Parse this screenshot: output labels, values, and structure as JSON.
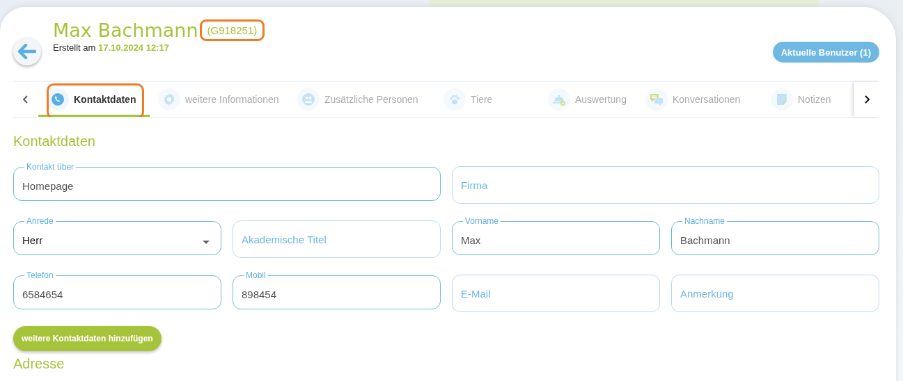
{
  "header": {
    "name": "Max Bachmann",
    "customer_id": "(G918251)",
    "customer_id_highlighted": true,
    "created_label": "Erstellt am",
    "created_at": "17.10.2024 12:17",
    "users_button": "Aktuelle Benutzer (1)"
  },
  "tabs": [
    {
      "label": "Kontaktdaten",
      "selected": true,
      "highlighted": true
    },
    {
      "label": "weitere Informationen",
      "selected": false,
      "highlighted": false
    },
    {
      "label": "Zusätzliche Personen",
      "selected": false,
      "highlighted": false
    },
    {
      "label": "Tiere",
      "selected": false,
      "highlighted": false
    },
    {
      "label": "Auswertung",
      "selected": false,
      "highlighted": false
    },
    {
      "label": "Konversationen",
      "selected": false,
      "highlighted": false
    },
    {
      "label": "Notizen",
      "selected": false,
      "highlighted": false
    }
  ],
  "section_title": "Kontaktdaten",
  "form_rows": [
    [
      {
        "kind": "text",
        "label": "Kontakt über",
        "value": "Homepage"
      },
      {
        "kind": "text",
        "placeholder": "Firma"
      }
    ],
    [
      {
        "kind": "select",
        "label": "Anrede",
        "value": "Herr"
      },
      {
        "kind": "text",
        "placeholder": "Akademische Titel"
      },
      {
        "kind": "text",
        "label": "Vorname",
        "value": "Max"
      },
      {
        "kind": "text",
        "label": "Nachname",
        "value": "Bachmann"
      }
    ],
    [
      {
        "kind": "text",
        "label": "Telefon",
        "value": "6584654"
      },
      {
        "kind": "text",
        "label": "Mobil",
        "value": "898454"
      },
      {
        "kind": "text",
        "placeholder": "E-Mail"
      },
      {
        "kind": "text",
        "placeholder": "Anmerkung"
      }
    ]
  ],
  "add_button": "weitere Kontaktdaten hinzufügen",
  "next_section_title": "Adresse"
}
